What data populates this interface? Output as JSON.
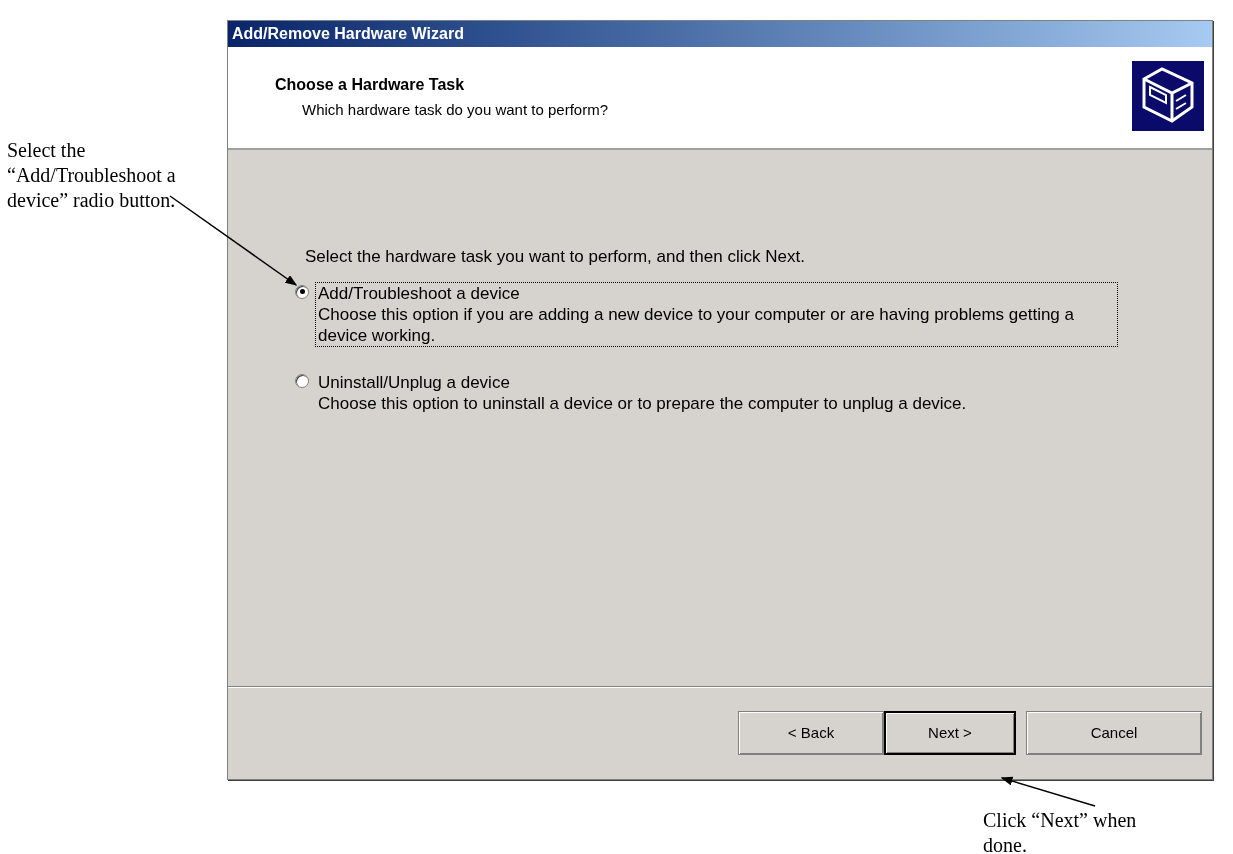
{
  "annotations": [
    {
      "text": "Select the “Add/Troubleshoot a device” radio button."
    },
    {
      "text": "Click “Next” when done."
    }
  ],
  "window": {
    "title": "Add/Remove Hardware Wizard"
  },
  "header": {
    "title": "Choose a Hardware Task",
    "subtitle": "Which hardware task do you want to perform?"
  },
  "instruction": "Select the hardware task you want to perform, and then click Next.",
  "options": [
    {
      "label": "Add/Troubleshoot a device",
      "description": "Choose this option if you are adding a new device to your computer or are having problems getting a device working.",
      "selected": true
    },
    {
      "label": "Uninstall/Unplug a device",
      "description": "Choose this option to uninstall a device or to prepare the computer to unplug a device.",
      "selected": false
    }
  ],
  "buttons": [
    {
      "label": "< Back",
      "default": false
    },
    {
      "label": "Next >",
      "default": true
    },
    {
      "label": "Cancel",
      "default": false
    }
  ]
}
